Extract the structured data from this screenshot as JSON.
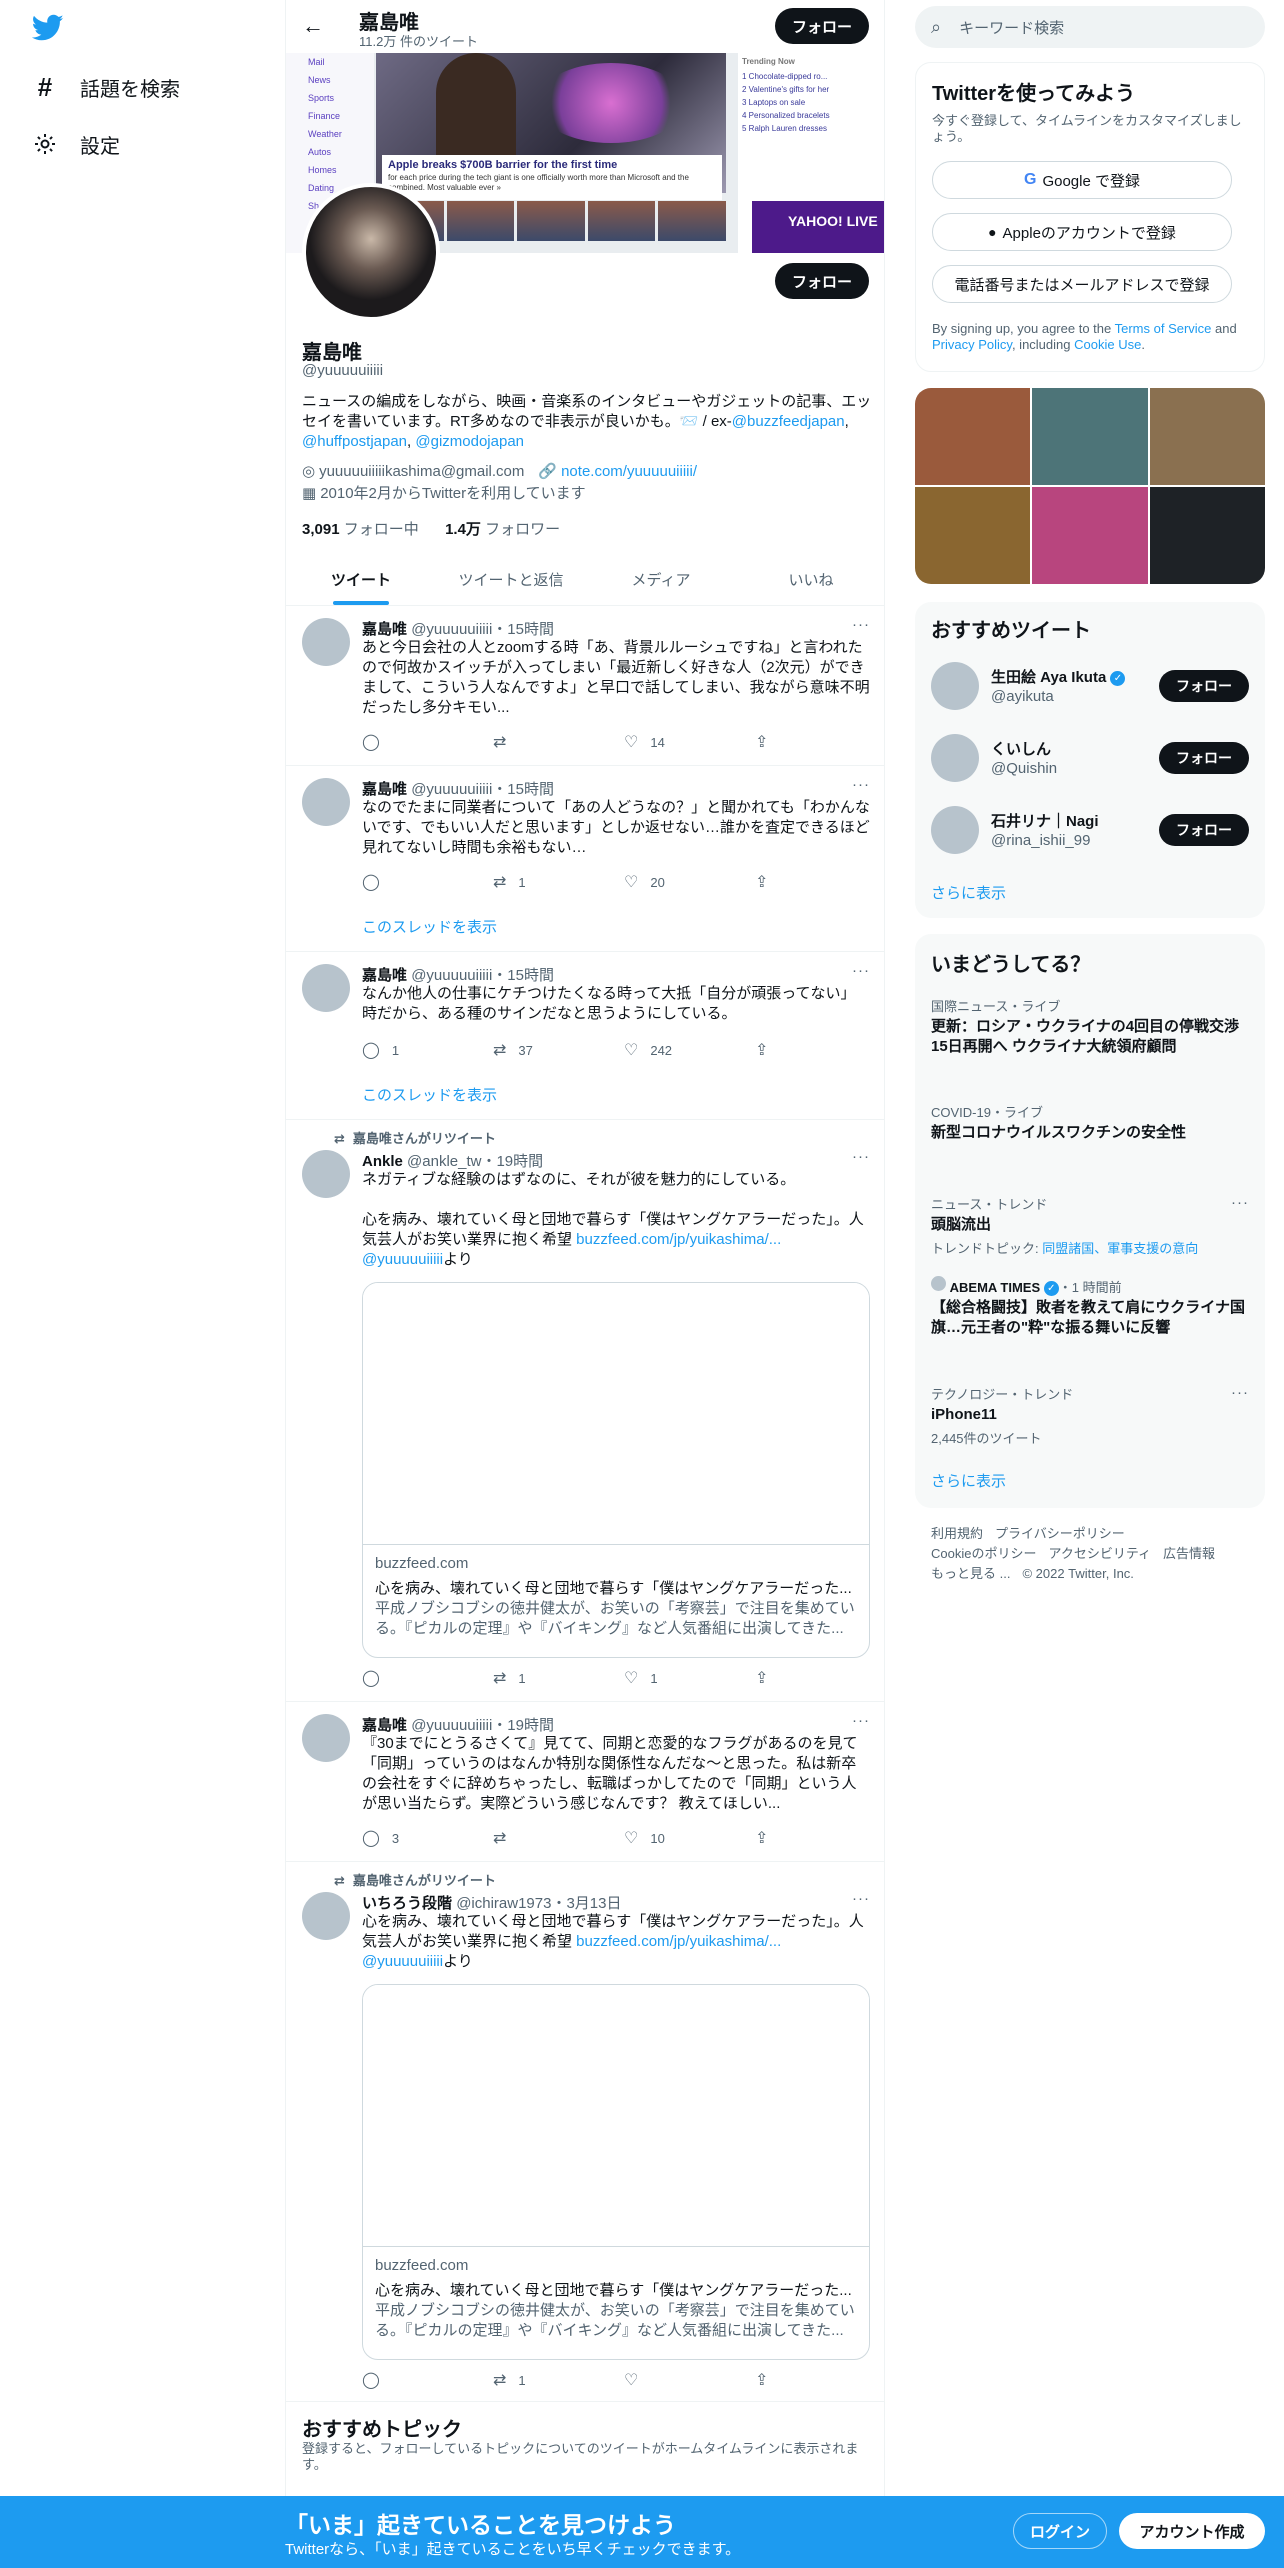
{
  "nav": {
    "explore": "話題を検索",
    "settings": "設定"
  },
  "header": {
    "name": "嘉島唯",
    "tweet_count": "11.2万 件のツイート",
    "follow": "フォロー"
  },
  "banner": {
    "left_items": [
      "Mail",
      "News",
      "Sports",
      "Finance",
      "Weather",
      "Autos",
      "Homes",
      "Dating",
      "Sh"
    ],
    "caption_headline": "Apple breaks $700B barrier for the first time",
    "caption_body": "for each price during the tech giant is one officially worth more than Microsoft and the combined. Most valuable ever »",
    "right_title": "Trending Now",
    "right_items": [
      "1 Chocolate-dipped ro...",
      "2 Valentine's gifts for her",
      "3 Laptops on sale",
      "4 Personalized bracelets",
      "5 Ralph Lauren dresses"
    ],
    "right_brand": "YAHOO! LIVE"
  },
  "profile": {
    "name": "嘉島唯",
    "handle": "@yuuuuuiiiii",
    "bio_text": "ニュースの編成をしながら、映画・音楽系のインタビューやガジェットの記事、エッセイを書いています。RT多めなので非表示が良いかも。📨 / ex-",
    "bio_link1": "@buzzfeedjapan",
    "bio_sep": ", ",
    "bio_link2": "@huffpostjapan",
    "bio_link3": "@gizmodojapan",
    "email": "yuuuuuiiiiikashima@gmail.com",
    "website": "note.com/yuuuuuiiiii/",
    "joined": "2010年2月からTwitterを利用しています",
    "following_count": "3,091",
    "following_label": "フォロー中",
    "followers_count": "1.4万",
    "followers_label": "フォロワー",
    "follow": "フォロー"
  },
  "tabs": [
    "ツイート",
    "ツイートと返信",
    "メディア",
    "いいね"
  ],
  "tweets": [
    {
      "name": "嘉島唯",
      "handle": "@yuuuuuiiiii",
      "time": "・15時間",
      "text": "あと今日会社の人とzoomする時「あ、背景ルルーシュですね」と言われたので何故かスイッチが入ってしまい「最近新しく好きな人（2次元）ができまして、こういう人なんですよ」と早口で話してしまい、我ながら意味不明だったし多分キモい...",
      "reply": "",
      "retweet": "",
      "like": "14"
    },
    {
      "name": "嘉島唯",
      "handle": "@yuuuuuiiiii",
      "time": "・15時間",
      "text": "なのでたまに同業者について「あの人どうなの？」と聞かれても「わかんないです、でもいい人だと思います」としか返せない…誰かを査定できるほど見れてないし時間も余裕もない…",
      "reply": "",
      "retweet": "1",
      "like": "20",
      "thread": "このスレッドを表示"
    },
    {
      "name": "嘉島唯",
      "handle": "@yuuuuuiiiii",
      "time": "・15時間",
      "text": "なんか他人の仕事にケチつけたくなる時って大抵「自分が頑張ってない」時だから、ある種のサインだなと思うようにしている。",
      "reply": "1",
      "retweet": "37",
      "like": "242",
      "thread": "このスレッドを表示"
    },
    {
      "rt_label": "嘉島唯さんがリツイート",
      "name": "Ankle",
      "handle": "@ankle_tw",
      "time": "・19時間",
      "text_line1": "ネガティブな経験のはずなのに、それが彼を魅力的にしている。",
      "text_line2": "心を病み、壊れていく母と団地で暮らす「僕はヤングケアラーだった」。人気芸人がお笑い業界に抱く希望 ",
      "link": "buzzfeed.com/jp/yuikashima/...",
      "mention": "@yuuuuuiiiii",
      "mention_suffix": "より",
      "card_domain": "buzzfeed.com",
      "card_title": "心を病み、壊れていく母と団地で暮らす「僕はヤングケアラーだった...",
      "card_desc": "平成ノブシコブシの徳井健太が、お笑いの「考察芸」で注目を集めている。『ピカルの定理』や『バイキング』など人気番組に出演してきた...",
      "reply": "",
      "retweet": "1",
      "like": "1"
    },
    {
      "name": "嘉島唯",
      "handle": "@yuuuuuiiiii",
      "time": "・19時間",
      "text": "『30までにとうるさくて』見てて、同期と恋愛的なフラグがあるのを見て「同期」っていうのはなんか特別な関係性なんだな〜と思った。私は新卒の会社をすぐに辞めちゃったし、転職ばっかしてたので「同期」という人が思い当たらず。実際どういう感じなんです？ 教えてほしい...",
      "reply": "3",
      "retweet": "",
      "like": "10"
    },
    {
      "rt_label": "嘉島唯さんがリツイート",
      "name": "いちろう段階",
      "handle": "@ichiraw1973",
      "time": "・3月13日",
      "text_line2": "心を病み、壊れていく母と団地で暮らす「僕はヤングケアラーだった」。人気芸人がお笑い業界に抱く希望 ",
      "link": "buzzfeed.com/jp/yuikashima/...",
      "mention": "@yuuuuuiiiii",
      "mention_suffix": "より",
      "card_domain": "buzzfeed.com",
      "card_title": "心を病み、壊れていく母と団地で暮らす「僕はヤングケアラーだった...",
      "card_desc": "平成ノブシコブシの徳井健太が、お笑いの「考察芸」で注目を集めている。『ピカルの定理』や『バイキング』など人気番組に出演してきた...",
      "reply": "",
      "retweet": "1",
      "like": ""
    }
  ],
  "topics": {
    "title": "おすすめトピック",
    "subtitle": "登録すると、フォローしているトピックについてのツイートがホームタイムラインに表示されます。"
  },
  "right": {
    "search_placeholder": "キーワード検索",
    "signup_title": "Twitterを使ってみよう",
    "signup_sub": "今すぐ登録して、タイムラインをカスタマイズしましょう。",
    "google": "Google で登録",
    "apple": "Appleのアカウントで登録",
    "phone": "電話番号またはメールアドレスで登録",
    "legal_pre": "By signing up, you agree to the ",
    "legal_tos": "Terms of Service",
    "legal_and": " and ",
    "legal_privacy": "Privacy Policy",
    "legal_incl": ", including ",
    "legal_cookie": "Cookie Use",
    "legal_end": ".",
    "mosaic_colors": [
      "#9a5a3c",
      "#4d7478",
      "#8a7050",
      "#8a6630",
      "#b8457e",
      "#1e2226"
    ],
    "rec_title": "おすすめツイート",
    "recs": [
      {
        "name": "生田絵 Aya Ikuta",
        "handle": "@ayikuta",
        "verified": true,
        "follow": "フォロー"
      },
      {
        "name": "くいしん",
        "handle": "@Quishin",
        "follow": "フォロー"
      },
      {
        "name": "石井リナ｜Nagi",
        "handle": "@rina_ishii_99",
        "follow": "フォロー"
      }
    ],
    "more": "さらに表示",
    "trends_title": "いまどうしてる？",
    "trends": [
      {
        "cat": "国際ニュース・ライブ",
        "title": "更新：ロシア・ウクライナの4回目の停戦交渉 15日再開へ ウクライナ大統領府顧問"
      },
      {
        "cat": "COVID-19・ライブ",
        "title": "新型コロナウイルスワクチンの安全性"
      },
      {
        "cat": "ニュース・トレンド",
        "title": "頭脳流出",
        "sub_pre": "トレンドトピック: ",
        "sub_link": "同盟諸国、軍事支援の意向"
      },
      {
        "cat": "ABEMA TIMES",
        "cat_time": "・1 時間前",
        "title": "【総合格闘技】敗者を教えて肩にウクライナ国旗…元王者の\"粋\"な振る舞いに反響"
      },
      {
        "cat": "テクノロジー・トレンド",
        "title": "iPhone11",
        "sub": "2,445件のツイート"
      }
    ],
    "trends_more": "さらに表示",
    "footer": [
      "利用規約",
      "プライバシーポリシー",
      "Cookieのポリシー",
      "アクセシビリティ",
      "広告情報",
      "もっと見る ...",
      "© 2022 Twitter, Inc."
    ]
  },
  "bottom": {
    "title": "「いま」起きていることを見つけよう",
    "sub": "Twitterなら、「いま」起きていることをいち早くチェックできます。",
    "login": "ログイン",
    "signup": "アカウント作成"
  }
}
